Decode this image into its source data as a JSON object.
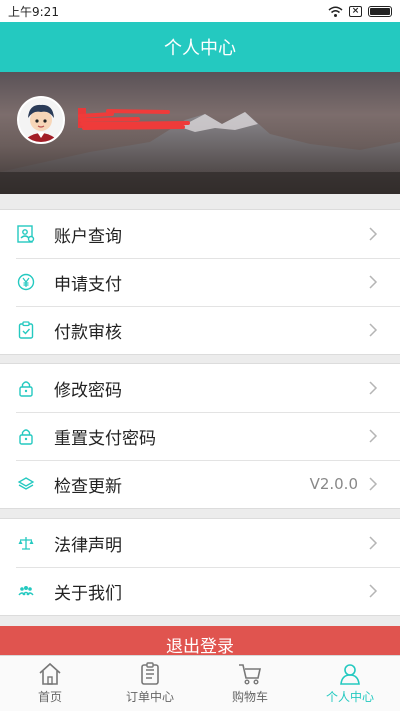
{
  "status": {
    "time": "上午9:21"
  },
  "header": {
    "title": "个人中心"
  },
  "profile": {
    "username": ""
  },
  "groups": [
    {
      "items": [
        {
          "label": "账户查询",
          "icon": "account-query-icon"
        },
        {
          "label": "申请支付",
          "icon": "yen-icon"
        },
        {
          "label": "付款审核",
          "icon": "clipboard-check-icon"
        }
      ]
    },
    {
      "items": [
        {
          "label": "修改密码",
          "icon": "lock-icon"
        },
        {
          "label": "重置支付密码",
          "icon": "lock-icon"
        },
        {
          "label": "检查更新",
          "icon": "layers-icon",
          "value": "V2.0.0"
        }
      ]
    },
    {
      "items": [
        {
          "label": "法律声明",
          "icon": "scales-icon"
        },
        {
          "label": "关于我们",
          "icon": "people-icon"
        }
      ]
    }
  ],
  "logout": {
    "label": "退出登录"
  },
  "tabbar": [
    {
      "label": "首页",
      "icon": "home-icon",
      "active": false
    },
    {
      "label": "订单中心",
      "icon": "order-icon",
      "active": false
    },
    {
      "label": "购物车",
      "icon": "cart-icon",
      "active": false
    },
    {
      "label": "个人中心",
      "icon": "person-icon",
      "active": true
    }
  ],
  "colors": {
    "accent": "#24c9c0",
    "logout": "#e0544f"
  }
}
